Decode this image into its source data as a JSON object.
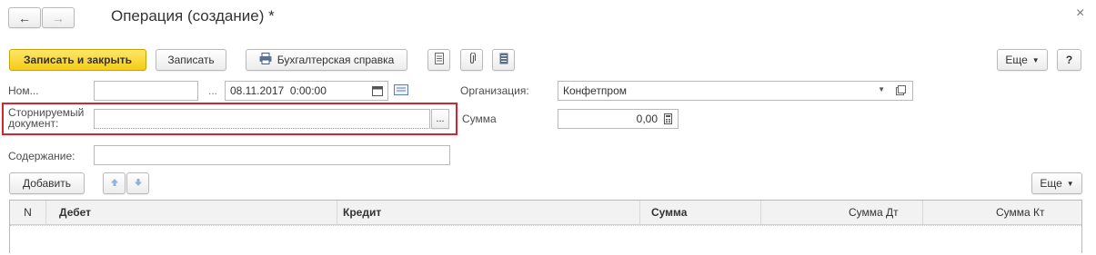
{
  "nav": {
    "back_symbol": "←",
    "forward_symbol": "→"
  },
  "window": {
    "title": "Операция (создание) *",
    "close_symbol": "×"
  },
  "toolbar": {
    "save_close_label": "Записать и закрыть",
    "save_label": "Записать",
    "accounting_ref_label": "Бухгалтерская справка",
    "more_label": "Еще",
    "help_label": "?"
  },
  "form": {
    "number_label": "Ном...",
    "number_value": "",
    "from_label": "...",
    "date_value": "08.11.2017  0:00:00",
    "organization_label": "Организация:",
    "organization_value": "Конфетпром",
    "reversed_doc_label_line1": "Сторнируемый",
    "reversed_doc_label_line2": "документ:",
    "reversed_doc_value": "",
    "amount_label": "Сумма",
    "amount_value": "0,00",
    "content_label": "Содержание:",
    "content_value": ""
  },
  "table_toolbar": {
    "add_label": "Добавить",
    "more_label": "Еще"
  },
  "table": {
    "columns": [
      "N",
      "Дебет",
      "Кредит",
      "Сумма",
      "Сумма Дт",
      "Сумма Кт"
    ],
    "rows": []
  },
  "colors": {
    "highlight_frame": "#d0262c",
    "primary_button": "#f4cd16"
  }
}
